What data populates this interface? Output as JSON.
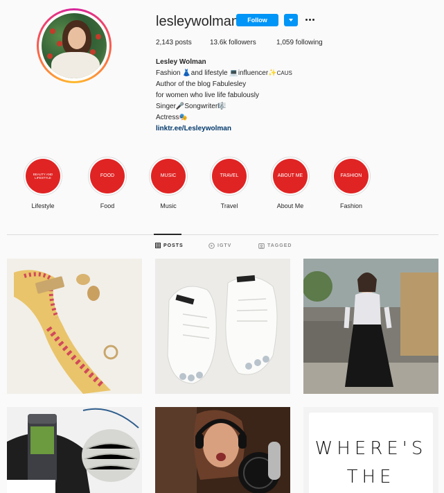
{
  "profile": {
    "username": "lesleywolman",
    "follow_label": "Follow",
    "stats": [
      {
        "label": "2,143 posts"
      },
      {
        "label": "13.6k followers"
      },
      {
        "label": "1,059 following"
      }
    ],
    "bio": {
      "name": "Lesley Wolman",
      "line1": "Fashion 👗and lifestyle 💻influencer✨",
      "line1_suffix": "CAUS",
      "line2": "Author of the blog Fabulesley",
      "line3": "for women who live life fabulously",
      "line4": "Singer🎤Songwriter🎼",
      "line5": "Actress🎭",
      "link": "linktr.ee/Lesleywolman"
    }
  },
  "highlights": [
    {
      "cover": "BEAUTY AND LIFESTYLE",
      "label": "Lifestyle"
    },
    {
      "cover": "FOOD",
      "label": "Food"
    },
    {
      "cover": "MUSIC",
      "label": "Music"
    },
    {
      "cover": "TRAVEL",
      "label": "Travel"
    },
    {
      "cover": "ABOUT ME",
      "label": "About Me"
    },
    {
      "cover": "FASHION",
      "label": "Fashion"
    }
  ],
  "tabs": [
    {
      "label": "POSTS",
      "icon": "grid-icon",
      "active": true
    },
    {
      "label": "IGTV",
      "icon": "tv-icon",
      "active": false
    },
    {
      "label": "TAGGED",
      "icon": "tag-icon",
      "active": false
    }
  ],
  "posts": {
    "sixth_text_line1": "WHERE'S",
    "sixth_text_line2": "THE"
  },
  "colors": {
    "follow_blue": "#0095f6",
    "highlight_red": "#e02424",
    "link_blue": "#00376b"
  }
}
